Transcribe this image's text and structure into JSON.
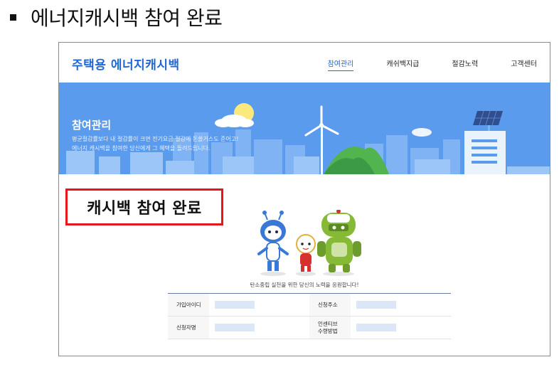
{
  "doc": {
    "title": "에너지캐시백 참여 완료"
  },
  "site": {
    "brand": "주택용 에너지캐시백",
    "nav": [
      {
        "label": "참여관리",
        "active": true
      },
      {
        "label": "캐쉬백지급",
        "active": false
      },
      {
        "label": "절감노력",
        "active": false
      },
      {
        "label": "고객센터",
        "active": false
      }
    ]
  },
  "banner": {
    "title": "참여관리",
    "desc_line1": "평균절감률보다 내 절감률이 크면 전기요금 절감에 돈쓸거스도 준어고!",
    "desc_line2": "에너지 캐시백을 참여한 당신에게 그 혜택을 돌려드립니다."
  },
  "callout": {
    "text": "캐시백 참여 완료"
  },
  "message": "탄소중립 실천을 위한 당신의 노력을 응원합니다!",
  "table": {
    "rows": [
      {
        "left_label": "가입아이디",
        "right_label": "신청주소"
      },
      {
        "left_label": "신청자명",
        "right_label_line1": "인센티브",
        "right_label_line2": "수령방법"
      }
    ]
  },
  "colors": {
    "brand_blue": "#1f66d6",
    "banner_blue": "#5b9bee",
    "callout_red": "#e8161b",
    "value_placeholder": "#dbe6f7"
  }
}
